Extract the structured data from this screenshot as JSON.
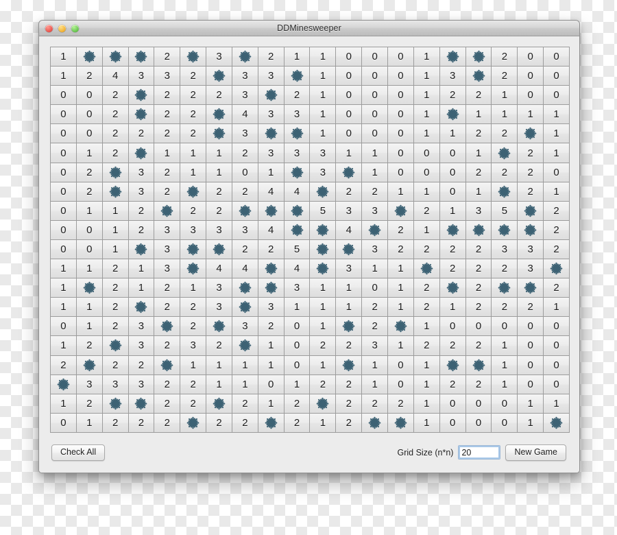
{
  "window": {
    "title": "DDMinesweeper",
    "controls": {
      "close": "close",
      "minimize": "minimize",
      "maximize": "maximize"
    }
  },
  "footer": {
    "check_all_label": "Check All",
    "grid_size_label": "Grid Size (n*n)",
    "grid_size_value": "20",
    "new_game_label": "New Game"
  },
  "board": {
    "size": 20,
    "mine_symbol": "mine-icon",
    "mine_color": "#3d6274",
    "text_color": "#1c1c1c",
    "rows": [
      [
        "1",
        "*",
        "*",
        "*",
        "2",
        "*",
        "3",
        "*",
        "2",
        "1",
        "1",
        "0",
        "0",
        "0",
        "1",
        "*",
        "*",
        "2",
        "0",
        "0"
      ],
      [
        "1",
        "2",
        "4",
        "3",
        "3",
        "2",
        "*",
        "3",
        "3",
        "*",
        "1",
        "0",
        "0",
        "0",
        "1",
        "3",
        "*",
        "2",
        "0",
        "0"
      ],
      [
        "0",
        "0",
        "2",
        "*",
        "2",
        "2",
        "2",
        "3",
        "*",
        "2",
        "1",
        "0",
        "0",
        "0",
        "1",
        "2",
        "2",
        "1",
        "0",
        "0"
      ],
      [
        "0",
        "0",
        "2",
        "*",
        "2",
        "2",
        "*",
        "4",
        "3",
        "3",
        "1",
        "0",
        "0",
        "0",
        "1",
        "*",
        "1",
        "1",
        "1",
        "1"
      ],
      [
        "0",
        "0",
        "2",
        "2",
        "2",
        "2",
        "*",
        "3",
        "*",
        "*",
        "1",
        "0",
        "0",
        "0",
        "1",
        "1",
        "2",
        "2",
        "*",
        "1"
      ],
      [
        "0",
        "1",
        "2",
        "*",
        "1",
        "1",
        "1",
        "2",
        "3",
        "3",
        "3",
        "1",
        "1",
        "0",
        "0",
        "0",
        "1",
        "*",
        "2",
        "1"
      ],
      [
        "0",
        "2",
        "*",
        "3",
        "2",
        "1",
        "1",
        "0",
        "1",
        "*",
        "3",
        "*",
        "1",
        "0",
        "0",
        "0",
        "2",
        "2",
        "2",
        "0"
      ],
      [
        "0",
        "2",
        "*",
        "3",
        "2",
        "*",
        "2",
        "2",
        "4",
        "4",
        "*",
        "2",
        "2",
        "1",
        "1",
        "0",
        "1",
        "*",
        "2",
        "1"
      ],
      [
        "0",
        "1",
        "1",
        "2",
        "*",
        "2",
        "2",
        "*",
        "*",
        "*",
        "5",
        "3",
        "3",
        "*",
        "2",
        "1",
        "3",
        "5",
        "*",
        "2"
      ],
      [
        "0",
        "0",
        "1",
        "2",
        "3",
        "3",
        "3",
        "3",
        "4",
        "*",
        "*",
        "4",
        "*",
        "2",
        "1",
        "*",
        "*",
        "*",
        "*",
        "2"
      ],
      [
        "0",
        "0",
        "1",
        "*",
        "3",
        "*",
        "*",
        "2",
        "2",
        "5",
        "*",
        "*",
        "3",
        "2",
        "2",
        "2",
        "2",
        "3",
        "3",
        "2"
      ],
      [
        "1",
        "1",
        "2",
        "1",
        "3",
        "*",
        "4",
        "4",
        "*",
        "4",
        "*",
        "3",
        "1",
        "1",
        "*",
        "2",
        "2",
        "2",
        "3",
        "*"
      ],
      [
        "1",
        "*",
        "2",
        "1",
        "2",
        "1",
        "3",
        "*",
        "*",
        "3",
        "1",
        "1",
        "0",
        "1",
        "2",
        "*",
        "2",
        "*",
        "*",
        "2"
      ],
      [
        "1",
        "1",
        "2",
        "*",
        "2",
        "2",
        "3",
        "*",
        "3",
        "1",
        "1",
        "1",
        "2",
        "1",
        "2",
        "1",
        "2",
        "2",
        "2",
        "1"
      ],
      [
        "0",
        "1",
        "2",
        "3",
        "*",
        "2",
        "*",
        "3",
        "2",
        "0",
        "1",
        "*",
        "2",
        "*",
        "1",
        "0",
        "0",
        "0",
        "0",
        "0"
      ],
      [
        "1",
        "2",
        "*",
        "3",
        "2",
        "3",
        "2",
        "*",
        "1",
        "0",
        "2",
        "2",
        "3",
        "1",
        "2",
        "2",
        "2",
        "1",
        "0",
        "0"
      ],
      [
        "2",
        "*",
        "2",
        "2",
        "*",
        "1",
        "1",
        "1",
        "1",
        "0",
        "1",
        "*",
        "1",
        "0",
        "1",
        "*",
        "*",
        "1",
        "0",
        "0"
      ],
      [
        "*",
        "3",
        "3",
        "3",
        "2",
        "2",
        "1",
        "1",
        "0",
        "1",
        "2",
        "2",
        "1",
        "0",
        "1",
        "2",
        "2",
        "1",
        "0",
        "0"
      ],
      [
        "1",
        "2",
        "*",
        "*",
        "2",
        "2",
        "*",
        "2",
        "1",
        "2",
        "*",
        "2",
        "2",
        "2",
        "1",
        "0",
        "0",
        "0",
        "1",
        "1"
      ],
      [
        "0",
        "1",
        "2",
        "2",
        "2",
        "*",
        "2",
        "2",
        "*",
        "2",
        "1",
        "2",
        "*",
        "*",
        "1",
        "0",
        "0",
        "0",
        "1",
        "*"
      ]
    ]
  }
}
